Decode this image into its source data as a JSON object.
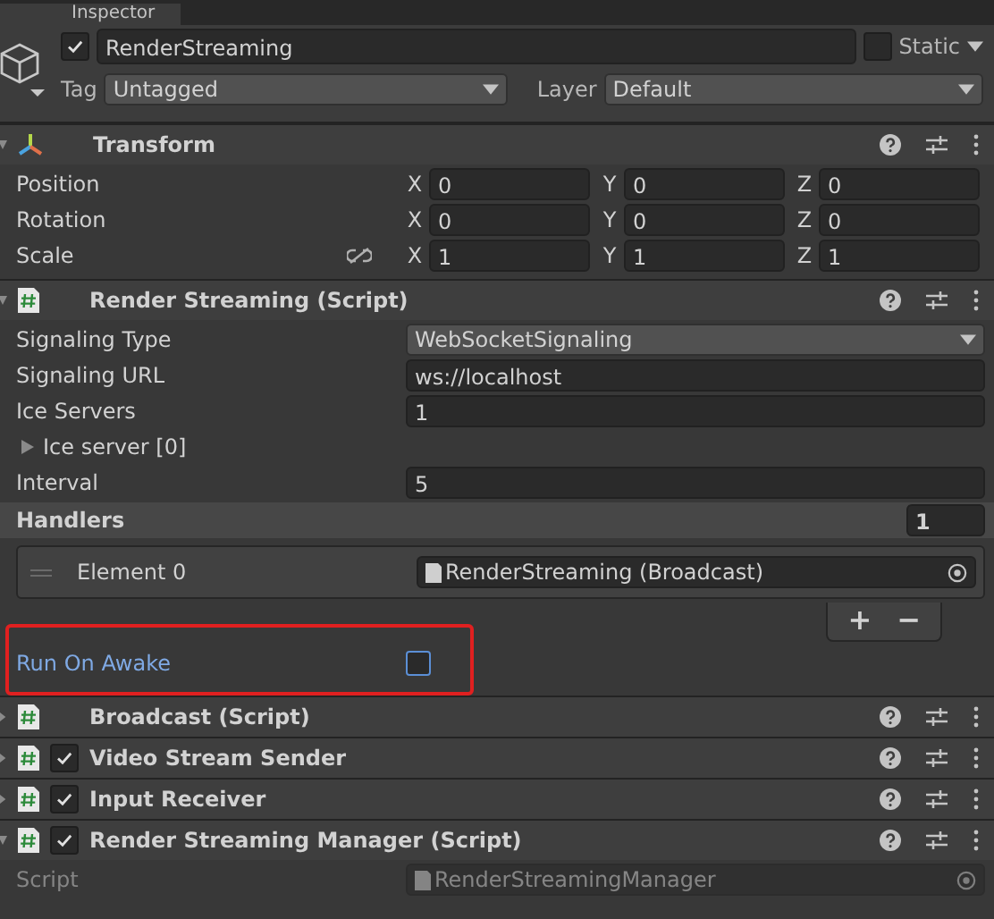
{
  "window": {
    "tab": "Inspector"
  },
  "object": {
    "active": true,
    "name": "RenderStreaming",
    "static": false,
    "static_label": "Static",
    "tag_label": "Tag",
    "tag": "Untagged",
    "layer_label": "Layer",
    "layer": "Default"
  },
  "components": [
    {
      "title": "Transform",
      "kind": "transform",
      "expanded": true,
      "fields": [
        {
          "kind": "vector3",
          "label": "Position",
          "values": [
            {
              "axis": "X",
              "value": "0"
            },
            {
              "axis": "Y",
              "value": "0"
            },
            {
              "axis": "Z",
              "value": "0"
            }
          ]
        },
        {
          "kind": "vector3",
          "label": "Rotation",
          "values": [
            {
              "axis": "X",
              "value": "0"
            },
            {
              "axis": "Y",
              "value": "0"
            },
            {
              "axis": "Z",
              "value": "0"
            }
          ]
        },
        {
          "kind": "vector3",
          "label": "Scale",
          "linked": false,
          "values": [
            {
              "axis": "X",
              "value": "1"
            },
            {
              "axis": "Y",
              "value": "1"
            },
            {
              "axis": "Z",
              "value": "1"
            }
          ]
        }
      ]
    },
    {
      "title": "Render Streaming (Script)",
      "kind": "script",
      "expanded": true,
      "fields": [
        {
          "kind": "dropdown",
          "label": "Signaling Type",
          "value": "WebSocketSignaling"
        },
        {
          "kind": "text",
          "label": "Signaling URL",
          "value": "ws://localhost"
        },
        {
          "kind": "text",
          "label": "Ice Servers",
          "value": "1"
        },
        {
          "kind": "foldout",
          "label": "Ice server [0]",
          "expanded": false
        },
        {
          "kind": "text",
          "label": "Interval",
          "value": "5"
        },
        {
          "kind": "list",
          "label": "Handlers",
          "count": "1",
          "elements": [
            {
              "label": "Element 0",
              "value": "RenderStreaming (Broadcast)"
            }
          ],
          "add": "+",
          "remove": "−"
        },
        {
          "kind": "checkbox",
          "label": "Run On Awake",
          "checked": false,
          "highlighted": true
        }
      ]
    },
    {
      "title": "Broadcast (Script)",
      "kind": "script",
      "expanded": false
    },
    {
      "title": "Video Stream Sender",
      "kind": "script",
      "expanded": false,
      "enabled": true
    },
    {
      "title": "Input Receiver",
      "kind": "script",
      "expanded": false,
      "enabled": true
    },
    {
      "title": "Render Streaming Manager (Script)",
      "kind": "script",
      "expanded": true,
      "enabled": true,
      "fields": [
        {
          "kind": "object",
          "label": "Script",
          "value": "RenderStreamingManager",
          "disabled": true
        }
      ]
    }
  ]
}
